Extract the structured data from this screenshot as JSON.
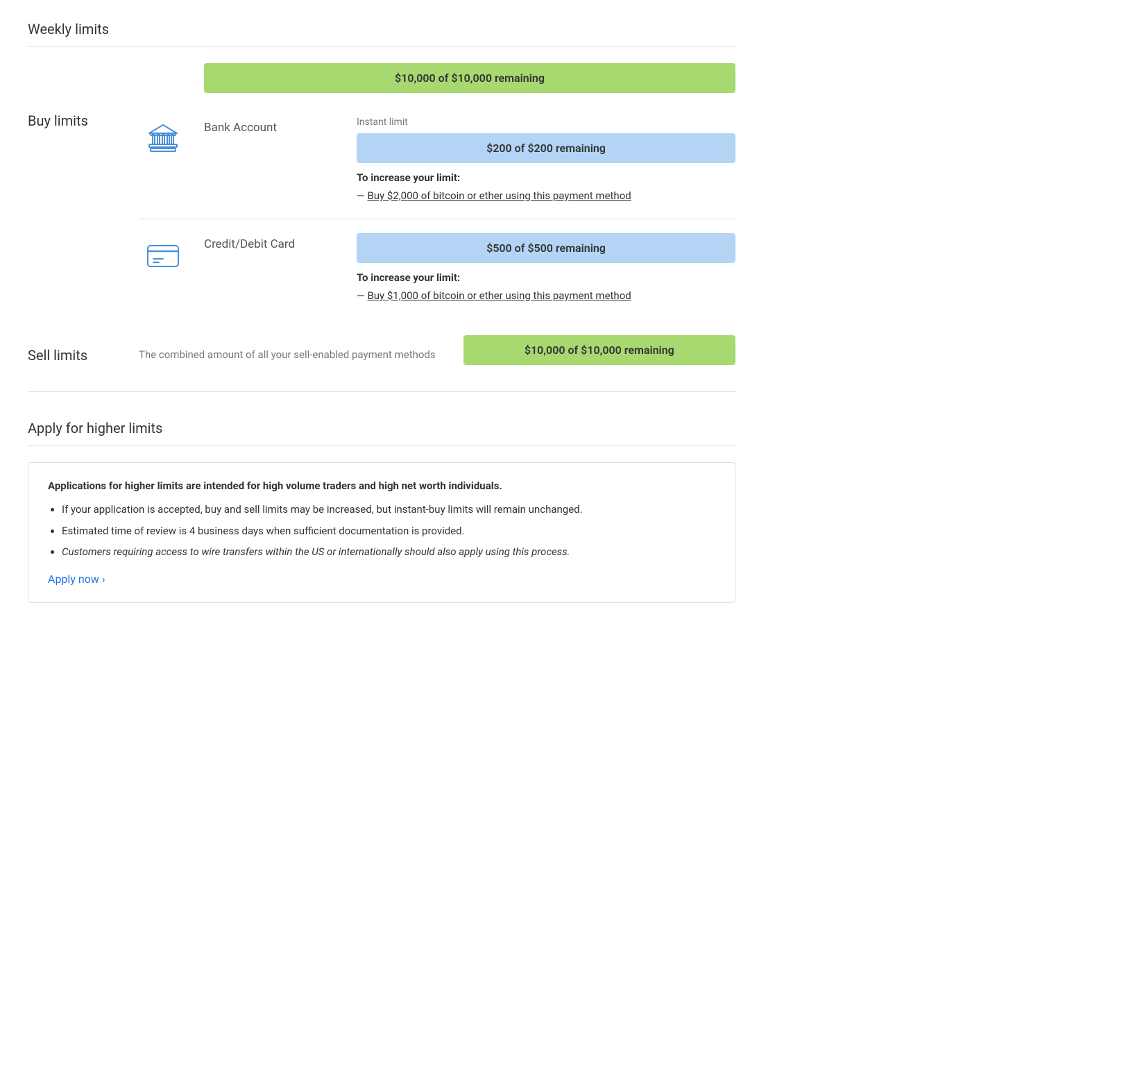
{
  "weekly_limits": {
    "section_title": "Weekly limits",
    "overall_limit": {
      "bar_text": "$10,000 of $10,000 remaining",
      "color": "green"
    }
  },
  "buy_limits": {
    "section_label": "Buy limits",
    "payment_methods": [
      {
        "name": "Bank Account",
        "icon": "bank",
        "instant_limit_label": "Instant limit",
        "instant_bar_text": "$200 of $200 remaining",
        "instant_bar_color": "blue",
        "increase_label": "To increase your limit:",
        "increase_link_text": "Buy $2,000 of bitcoin or ether using this payment method"
      },
      {
        "name": "Credit/Debit Card",
        "icon": "card",
        "instant_limit_label": null,
        "instant_bar_text": "$500 of $500 remaining",
        "instant_bar_color": "blue",
        "increase_label": "To increase your limit:",
        "increase_link_text": "Buy $1,000 of bitcoin or ether using this payment method"
      }
    ]
  },
  "sell_limits": {
    "section_label": "Sell limits",
    "description": "The combined amount of all your sell-enabled payment methods",
    "bar_text": "$10,000 of $10,000 remaining",
    "bar_color": "green"
  },
  "apply_section": {
    "title": "Apply for higher limits",
    "box_title": "Applications for higher limits are intended for high volume traders and high net worth individuals.",
    "bullets": [
      "If your application is accepted, buy and sell limits may be increased, but instant-buy limits will remain unchanged.",
      "Estimated time of review is 4 business days when sufficient documentation is provided.",
      "Customers requiring access to wire transfers within the US or internationally should also apply using this process."
    ],
    "bullet_italic_index": 2,
    "apply_link_text": "Apply now ›"
  }
}
